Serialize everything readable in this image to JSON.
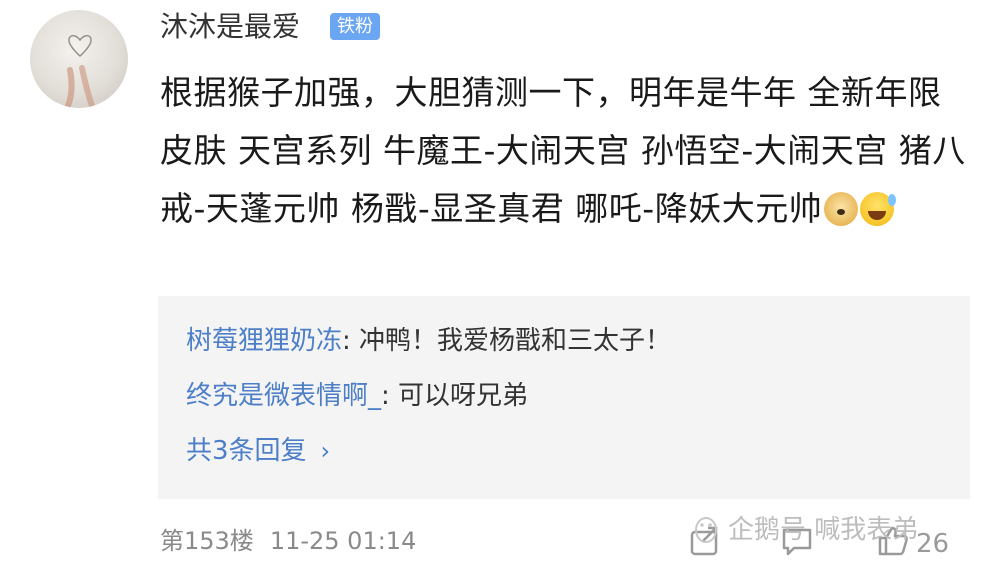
{
  "comment": {
    "username": "沐沐是最爱",
    "badge": "铁粉",
    "content": "根据猴子加强，大胆猜测一下，明年是牛年 全新年限皮肤 天宫系列 牛魔王-大闹天宫 孙悟空-大闹天宫 猪八戒-天蓬元帅 杨戬-显圣真君 哪吒-降妖大元帅",
    "emojis": [
      "doge-emoji",
      "sweat-smile-emoji"
    ]
  },
  "replies": [
    {
      "author": "树莓狸狸奶冻",
      "separator": ": ",
      "text": "冲鸭！我爱杨戬和三太子！"
    },
    {
      "author": "终究是微表情啊_",
      "separator": ": ",
      "text": "可以呀兄弟"
    }
  ],
  "more_replies": "共3条回复",
  "footer": {
    "floor": "第153楼",
    "time": "11-25 01:14"
  },
  "actions": {
    "like_count": "26"
  },
  "watermark": "企鹅号 喊我表弟",
  "colors": {
    "link": "#4d7fc8",
    "badge": "#6aa6f2",
    "reply_bg": "#f4f4f4",
    "meta": "#8a8a8a"
  }
}
